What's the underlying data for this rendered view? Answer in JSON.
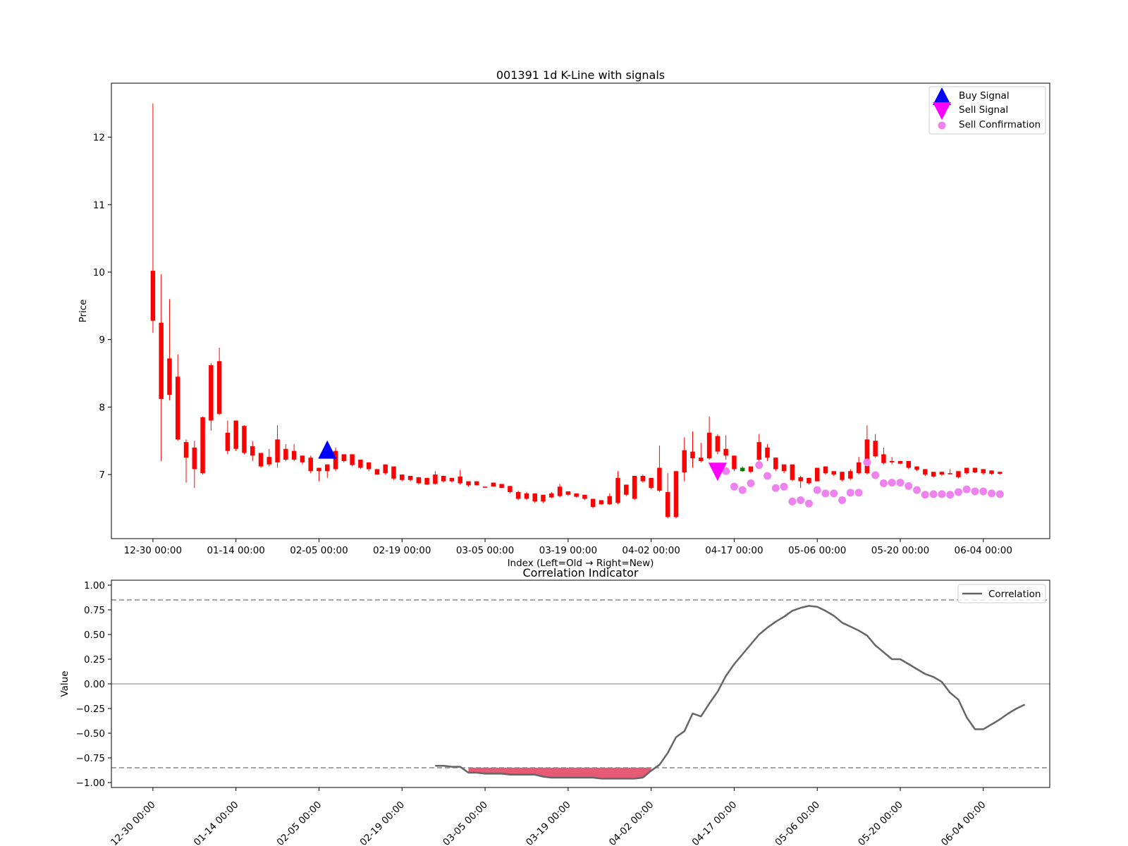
{
  "chart_data": [
    {
      "type": "candlestick",
      "title": "001391 1d K-Line with signals",
      "xlabel": "Index (Left=Old → Right=New)",
      "ylabel": "Price",
      "ylim": [
        6.05,
        12.8
      ],
      "yticks": [
        7,
        8,
        9,
        10,
        11,
        12
      ],
      "xlim": [
        -5,
        108
      ],
      "xticks": [
        {
          "index": 0,
          "label": "12-30 00:00"
        },
        {
          "index": 10,
          "label": "01-14 00:00"
        },
        {
          "index": 20,
          "label": "02-05 00:00"
        },
        {
          "index": 30,
          "label": "02-19 00:00"
        },
        {
          "index": 40,
          "label": "03-05 00:00"
        },
        {
          "index": 50,
          "label": "03-19 00:00"
        },
        {
          "index": 60,
          "label": "04-02 00:00"
        },
        {
          "index": 70,
          "label": "04-17 00:00"
        },
        {
          "index": 80,
          "label": "05-06 00:00"
        },
        {
          "index": 90,
          "label": "05-20 00:00"
        },
        {
          "index": 100,
          "label": "06-04 00:00"
        }
      ],
      "colors": {
        "up": "#ff0000",
        "down": "#008000",
        "buy": "#0000ff",
        "sell": "#ff00ff",
        "confirm": "#ee82ee"
      },
      "candles": [
        [
          10.02,
          12.5,
          9.1,
          9.28
        ],
        [
          9.25,
          9.97,
          7.2,
          8.12
        ],
        [
          8.72,
          9.6,
          8.1,
          8.18
        ],
        [
          8.45,
          8.78,
          7.5,
          7.52
        ],
        [
          7.48,
          7.52,
          6.88,
          7.25
        ],
        [
          7.4,
          7.5,
          6.8,
          7.08
        ],
        [
          7.85,
          7.86,
          7.0,
          7.02
        ],
        [
          8.62,
          8.65,
          7.65,
          7.8
        ],
        [
          8.68,
          8.88,
          7.88,
          7.9
        ],
        [
          7.62,
          7.8,
          7.3,
          7.35
        ],
        [
          7.8,
          7.8,
          7.35,
          7.38
        ],
        [
          7.72,
          7.73,
          7.3,
          7.32
        ],
        [
          7.42,
          7.5,
          7.2,
          7.28
        ],
        [
          7.32,
          7.32,
          7.1,
          7.12
        ],
        [
          7.26,
          7.38,
          7.12,
          7.15
        ],
        [
          7.52,
          7.73,
          7.1,
          7.18
        ],
        [
          7.38,
          7.45,
          7.2,
          7.22
        ],
        [
          7.35,
          7.45,
          7.2,
          7.22
        ],
        [
          7.28,
          7.28,
          7.15,
          7.18
        ],
        [
          7.25,
          7.28,
          7.02,
          7.05
        ],
        [
          7.1,
          7.1,
          6.9,
          7.05
        ],
        [
          7.15,
          7.15,
          6.95,
          7.05
        ],
        [
          7.35,
          7.4,
          7.05,
          7.08
        ],
        [
          7.3,
          7.3,
          7.18,
          7.2
        ],
        [
          7.3,
          7.3,
          7.12,
          7.14
        ],
        [
          7.22,
          7.22,
          7.08,
          7.1
        ],
        [
          7.18,
          7.18,
          7.05,
          7.08
        ],
        [
          7.08,
          7.08,
          7.0,
          7.0
        ],
        [
          7.15,
          7.15,
          7.0,
          7.02
        ],
        [
          7.12,
          7.12,
          6.92,
          6.94
        ],
        [
          7.0,
          7.0,
          6.9,
          6.92
        ],
        [
          6.98,
          6.98,
          6.9,
          6.92
        ],
        [
          6.96,
          6.96,
          6.85,
          6.87
        ],
        [
          6.95,
          6.95,
          6.85,
          6.85
        ],
        [
          7.0,
          7.05,
          6.85,
          6.86
        ],
        [
          6.98,
          6.98,
          6.88,
          6.9
        ],
        [
          6.95,
          6.95,
          6.88,
          6.9
        ],
        [
          6.97,
          7.07,
          6.85,
          6.87
        ],
        [
          6.9,
          6.9,
          6.82,
          6.84
        ],
        [
          6.9,
          6.9,
          6.84,
          6.84
        ],
        [
          6.82,
          6.82,
          6.8,
          6.81
        ],
        [
          6.88,
          6.88,
          6.82,
          6.82
        ],
        [
          6.86,
          6.86,
          6.8,
          6.8
        ],
        [
          6.83,
          6.83,
          6.72,
          6.74
        ],
        [
          6.74,
          6.76,
          6.62,
          6.64
        ],
        [
          6.72,
          6.74,
          6.62,
          6.64
        ],
        [
          6.72,
          6.72,
          6.58,
          6.6
        ],
        [
          6.7,
          6.7,
          6.58,
          6.6
        ],
        [
          6.72,
          6.74,
          6.65,
          6.66
        ],
        [
          6.82,
          6.86,
          6.66,
          6.68
        ],
        [
          6.75,
          6.75,
          6.68,
          6.7
        ],
        [
          6.72,
          6.72,
          6.66,
          6.67
        ],
        [
          6.7,
          6.7,
          6.62,
          6.64
        ],
        [
          6.64,
          6.64,
          6.5,
          6.52
        ],
        [
          6.62,
          6.62,
          6.55,
          6.56
        ],
        [
          6.68,
          6.72,
          6.55,
          6.56
        ],
        [
          6.95,
          7.05,
          6.56,
          6.58
        ],
        [
          6.85,
          6.85,
          6.68,
          6.7
        ],
        [
          6.98,
          6.98,
          6.62,
          6.64
        ],
        [
          6.98,
          7.0,
          6.88,
          6.9
        ],
        [
          6.95,
          6.95,
          6.78,
          6.8
        ],
        [
          7.1,
          7.43,
          6.74,
          6.76
        ],
        [
          6.74,
          7.02,
          6.35,
          6.37
        ],
        [
          7.05,
          7.05,
          6.35,
          6.37
        ],
        [
          7.36,
          7.55,
          6.9,
          7.03
        ],
        [
          7.34,
          7.64,
          7.1,
          7.24
        ],
        [
          7.25,
          7.47,
          7.18,
          7.2
        ],
        [
          7.62,
          7.86,
          7.22,
          7.24
        ],
        [
          7.57,
          7.6,
          7.3,
          7.34
        ],
        [
          7.38,
          7.58,
          7.22,
          7.28
        ],
        [
          7.28,
          7.28,
          7.05,
          7.08
        ],
        [
          7.05,
          7.12,
          7.04,
          7.1
        ],
        [
          7.12,
          7.12,
          7.02,
          7.04
        ],
        [
          7.48,
          7.6,
          7.2,
          7.22
        ],
        [
          7.4,
          7.45,
          7.2,
          7.25
        ],
        [
          7.25,
          7.25,
          7.05,
          7.08
        ],
        [
          7.15,
          7.15,
          7.02,
          7.05
        ],
        [
          7.15,
          7.15,
          6.9,
          6.92
        ],
        [
          6.96,
          6.98,
          6.8,
          6.9
        ],
        [
          6.95,
          6.95,
          6.85,
          6.87
        ],
        [
          7.1,
          7.1,
          6.9,
          6.9
        ],
        [
          7.12,
          7.12,
          7.0,
          7.02
        ],
        [
          7.05,
          7.05,
          6.98,
          7.0
        ],
        [
          7.04,
          7.04,
          6.9,
          6.92
        ],
        [
          7.05,
          7.08,
          6.92,
          6.94
        ],
        [
          7.18,
          7.26,
          7.0,
          7.02
        ],
        [
          7.52,
          7.73,
          7.0,
          7.02
        ],
        [
          7.5,
          7.6,
          7.25,
          7.27
        ],
        [
          7.3,
          7.4,
          7.15,
          7.17
        ],
        [
          7.2,
          7.26,
          7.15,
          7.18
        ],
        [
          7.2,
          7.2,
          7.15,
          7.16
        ],
        [
          7.2,
          7.2,
          7.08,
          7.1
        ],
        [
          7.12,
          7.12,
          7.05,
          7.07
        ],
        [
          7.08,
          7.08,
          6.98,
          7.0
        ],
        [
          7.04,
          7.04,
          6.95,
          6.97
        ],
        [
          7.04,
          7.04,
          6.98,
          7.0
        ],
        [
          7.02,
          7.08,
          7.0,
          7.01
        ],
        [
          7.05,
          7.05,
          6.94,
          6.96
        ],
        [
          7.1,
          7.1,
          7.0,
          7.02
        ],
        [
          7.1,
          7.1,
          7.02,
          7.03
        ],
        [
          7.08,
          7.08,
          7.0,
          7.02
        ],
        [
          7.06,
          7.06,
          7.0,
          7.01
        ],
        [
          7.04,
          7.04,
          7.0,
          7.01
        ]
      ],
      "buy_signals": [
        {
          "index": 21,
          "value": 7.36
        }
      ],
      "sell_signals": [
        {
          "index": 68,
          "value": 7.05
        }
      ],
      "sell_confirmations": [
        {
          "index": 69,
          "value": 7.05
        },
        {
          "index": 70,
          "value": 6.82
        },
        {
          "index": 71,
          "value": 6.77
        },
        {
          "index": 72,
          "value": 6.87
        },
        {
          "index": 73,
          "value": 7.14
        },
        {
          "index": 74,
          "value": 6.98
        },
        {
          "index": 75,
          "value": 6.8
        },
        {
          "index": 76,
          "value": 6.82
        },
        {
          "index": 77,
          "value": 6.6
        },
        {
          "index": 78,
          "value": 6.62
        },
        {
          "index": 79,
          "value": 6.57
        },
        {
          "index": 80,
          "value": 6.77
        },
        {
          "index": 81,
          "value": 6.72
        },
        {
          "index": 82,
          "value": 6.72
        },
        {
          "index": 83,
          "value": 6.62
        },
        {
          "index": 84,
          "value": 6.73
        },
        {
          "index": 85,
          "value": 6.73
        },
        {
          "index": 86,
          "value": 7.18
        },
        {
          "index": 87,
          "value": 6.99
        },
        {
          "index": 88,
          "value": 6.87
        },
        {
          "index": 89,
          "value": 6.88
        },
        {
          "index": 90,
          "value": 6.88
        },
        {
          "index": 91,
          "value": 6.83
        },
        {
          "index": 92,
          "value": 6.77
        },
        {
          "index": 93,
          "value": 6.7
        },
        {
          "index": 94,
          "value": 6.71
        },
        {
          "index": 95,
          "value": 6.71
        },
        {
          "index": 96,
          "value": 6.7
        },
        {
          "index": 97,
          "value": 6.74
        },
        {
          "index": 98,
          "value": 6.78
        },
        {
          "index": 99,
          "value": 6.75
        },
        {
          "index": 100,
          "value": 6.75
        },
        {
          "index": 101,
          "value": 6.72
        },
        {
          "index": 102,
          "value": 6.71
        }
      ],
      "legend": {
        "placement": "upper-right",
        "entries": [
          "Buy Signal",
          "Sell Signal",
          "Sell Confirmation"
        ]
      }
    },
    {
      "type": "line",
      "title": "Correlation Indicator",
      "ylabel": "Value",
      "ylim": [
        -1.05,
        1.05
      ],
      "yticks": [
        -1.0,
        -0.75,
        -0.5,
        -0.25,
        0.0,
        0.25,
        0.5,
        0.75,
        1.0
      ],
      "ytick_labels": [
        "−1.00",
        "−0.75",
        "−0.50",
        "−0.25",
        "0.00",
        "0.25",
        "0.50",
        "0.75",
        "1.00"
      ],
      "xtick_labels": [
        "12-30 00:00",
        "01-14 00:00",
        "02-05 00:00",
        "02-19 00:00",
        "03-05 00:00",
        "03-19 00:00",
        "04-02 00:00",
        "04-17 00:00",
        "05-06 00:00",
        "05-20 00:00",
        "06-04 00:00"
      ],
      "thresholds": [
        0.85,
        -0.85
      ],
      "zero_line": 0.0,
      "fill_below": -0.85,
      "fill_color": "#dc143c",
      "series": [
        {
          "name": "Correlation",
          "color": "#666666",
          "start_index": 34,
          "values": [
            -0.83,
            -0.83,
            -0.84,
            -0.84,
            -0.9,
            -0.9,
            -0.91,
            -0.91,
            -0.91,
            -0.92,
            -0.92,
            -0.92,
            -0.92,
            -0.94,
            -0.95,
            -0.95,
            -0.95,
            -0.95,
            -0.95,
            -0.95,
            -0.96,
            -0.96,
            -0.96,
            -0.96,
            -0.96,
            -0.95,
            -0.88,
            -0.82,
            -0.7,
            -0.54,
            -0.48,
            -0.3,
            -0.33,
            -0.2,
            -0.08,
            0.08,
            0.2,
            0.3,
            0.4,
            0.5,
            0.57,
            0.63,
            0.68,
            0.74,
            0.77,
            0.79,
            0.78,
            0.74,
            0.69,
            0.62,
            0.58,
            0.54,
            0.49,
            0.39,
            0.32,
            0.25,
            0.25,
            0.2,
            0.15,
            0.1,
            0.07,
            0.02,
            -0.09,
            -0.16,
            -0.34,
            -0.46,
            -0.46,
            -0.41,
            -0.36,
            -0.3,
            -0.25,
            -0.21
          ]
        }
      ],
      "legend": {
        "placement": "upper-right",
        "entries": [
          "Correlation"
        ]
      }
    }
  ]
}
